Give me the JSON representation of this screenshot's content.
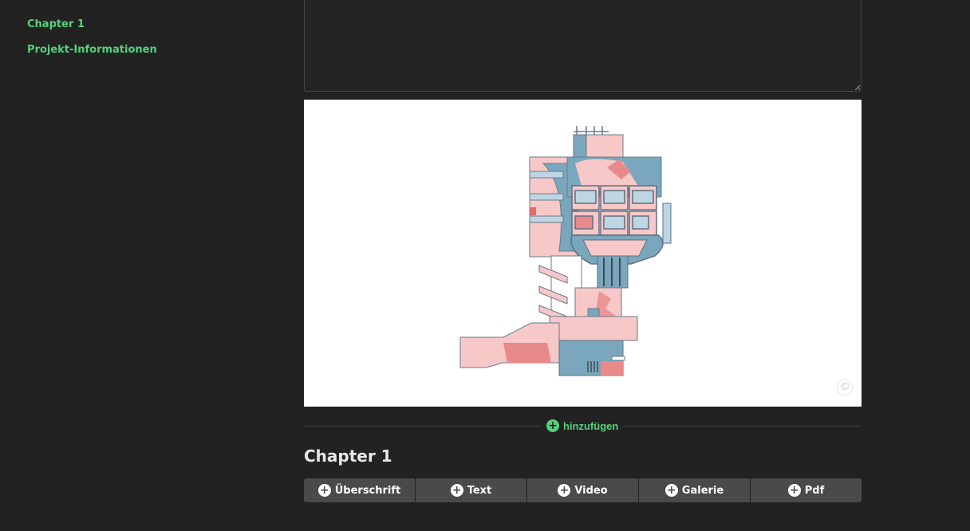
{
  "sidebar": {
    "items": [
      {
        "label": "Chapter 1"
      },
      {
        "label": "Projekt-Informationen"
      }
    ]
  },
  "editor": {
    "textarea_value": "",
    "image_alt": "building-illustration",
    "copyright_symbol": "©"
  },
  "add_section": {
    "icon": "+",
    "label": "hinzufügen"
  },
  "chapter": {
    "title": "Chapter 1",
    "buttons": [
      {
        "icon": "+",
        "label": "Überschrift"
      },
      {
        "icon": "+",
        "label": "Text"
      },
      {
        "icon": "+",
        "label": "Video"
      },
      {
        "icon": "+",
        "label": "Galerie"
      },
      {
        "icon": "+",
        "label": "Pdf"
      }
    ]
  },
  "colors": {
    "accent": "#52d27c",
    "background": "#222222",
    "button": "#4a4a4a"
  }
}
